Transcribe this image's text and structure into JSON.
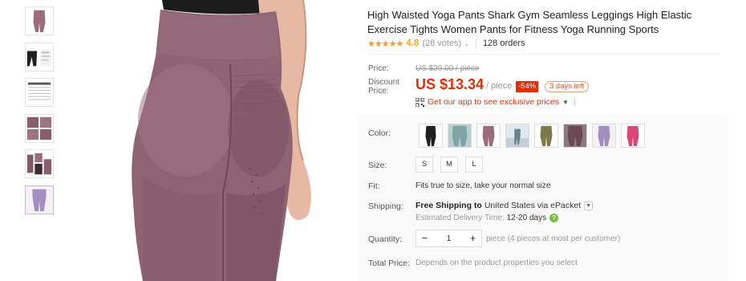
{
  "product": {
    "title": "High Waisted Yoga Pants Shark Gym Seamless Leggings High Elastic Exercise Tights Women Pants for Fitness Yoga Running Sports",
    "stars": "★★★★★",
    "rating": "4.8",
    "votes": "(28 votes)",
    "orders": "128 orders"
  },
  "price": {
    "price_label": "Price:",
    "old_price": "US $29.00 / piece",
    "discount_label_1": "Discount",
    "discount_label_2": "Price:",
    "current_price": "US $13.34",
    "per_piece": "/ piece",
    "discount_pct": "-54%",
    "days_left": "3 days left",
    "app_promo": "Get our app to see exclusive prices",
    "accent_color": "#e62e04"
  },
  "sku": {
    "color_label": "Color:",
    "color_options": [
      {
        "name": "black",
        "hex": "#1f1f1f"
      },
      {
        "name": "teal-grey",
        "hex": "#7fa3a6"
      },
      {
        "name": "mauve",
        "hex": "#9b6b7e"
      },
      {
        "name": "light-grey",
        "hex": "#a8b6bd"
      },
      {
        "name": "olive",
        "hex": "#7d7a4a"
      },
      {
        "name": "dark-mauve",
        "hex": "#6b4a55"
      },
      {
        "name": "lavender",
        "hex": "#a38ec2"
      },
      {
        "name": "hot-pink",
        "hex": "#d9467a"
      }
    ],
    "size_label": "Size:",
    "sizes": [
      "S",
      "M",
      "L"
    ],
    "fit_label": "Fit:",
    "fit_text": "Fits true to size, take your normal size"
  },
  "shipping": {
    "label": "Shipping:",
    "free": "Free Shipping to",
    "destination": "United States via ePacket",
    "est_label": "Estimated Delivery Time:",
    "est_days": "12-20 days"
  },
  "quantity": {
    "label": "Quantity:",
    "value": "1",
    "minus": "−",
    "plus": "+",
    "note": "piece (4 pieces at most per customer)"
  },
  "total": {
    "label": "Total Price:",
    "note": "Depends on the product properties you select"
  }
}
